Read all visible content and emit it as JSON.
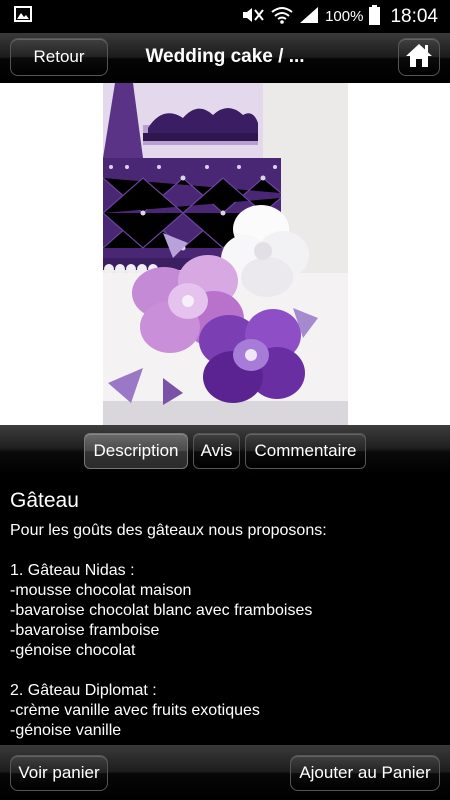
{
  "status": {
    "battery": "100%",
    "time": "18:04",
    "icons": [
      "image-notification-icon",
      "mute-icon",
      "wifi-icon",
      "signal-icon",
      "battery-icon"
    ]
  },
  "header": {
    "back_label": "Retour",
    "title": "Wedding cake / ...",
    "home_icon": "home-icon"
  },
  "tabs": [
    {
      "label": "Description",
      "active": true
    },
    {
      "label": "Avis",
      "active": false
    },
    {
      "label": "Commentaire",
      "active": false
    }
  ],
  "content": {
    "title": "Gâteau",
    "lines": [
      "Pour les goûts des gâteaux nous proposons:",
      "",
      "1. Gâteau Nidas :",
      "-mousse chocolat maison",
      "-bavaroise chocolat blanc avec framboises",
      "-bavaroise framboise",
      "-génoise chocolat",
      "",
      "2. Gâteau Diplomat :",
      "-crème vanille avec fruits exotiques",
      "-génoise vanille"
    ]
  },
  "footer": {
    "view_cart": "Voir panier",
    "add_cart": "Ajouter au Panier"
  },
  "colors": {
    "cake_purple": "#4a2775",
    "flower_pink": "#c58ad6",
    "background": "#000000"
  }
}
